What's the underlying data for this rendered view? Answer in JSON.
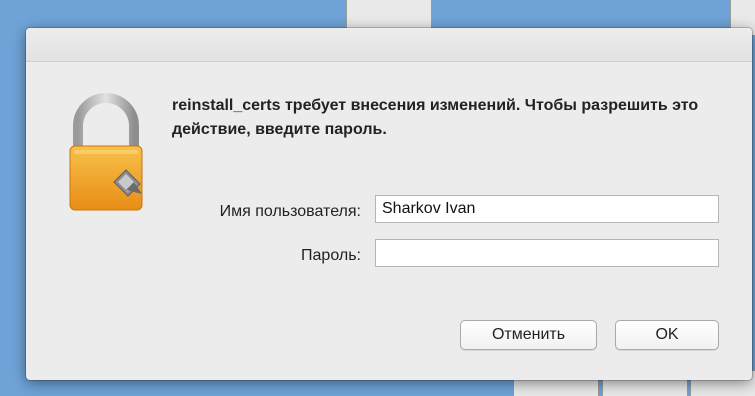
{
  "dialog": {
    "message": "reinstall_certs требует внесения изменений. Чтобы разрешить это действие, введите пароль.",
    "username_label": "Имя пользователя:",
    "username_value": "Sharkov Ivan",
    "password_label": "Пароль:",
    "password_value": "",
    "cancel_label": "Отменить",
    "ok_label": "OK",
    "icon": "lock-icon"
  },
  "colors": {
    "desktop_background": "#6fa3d8",
    "dialog_background": "#ececec",
    "lock_body": "#f0a028",
    "lock_shackle": "#b9b9b9"
  }
}
